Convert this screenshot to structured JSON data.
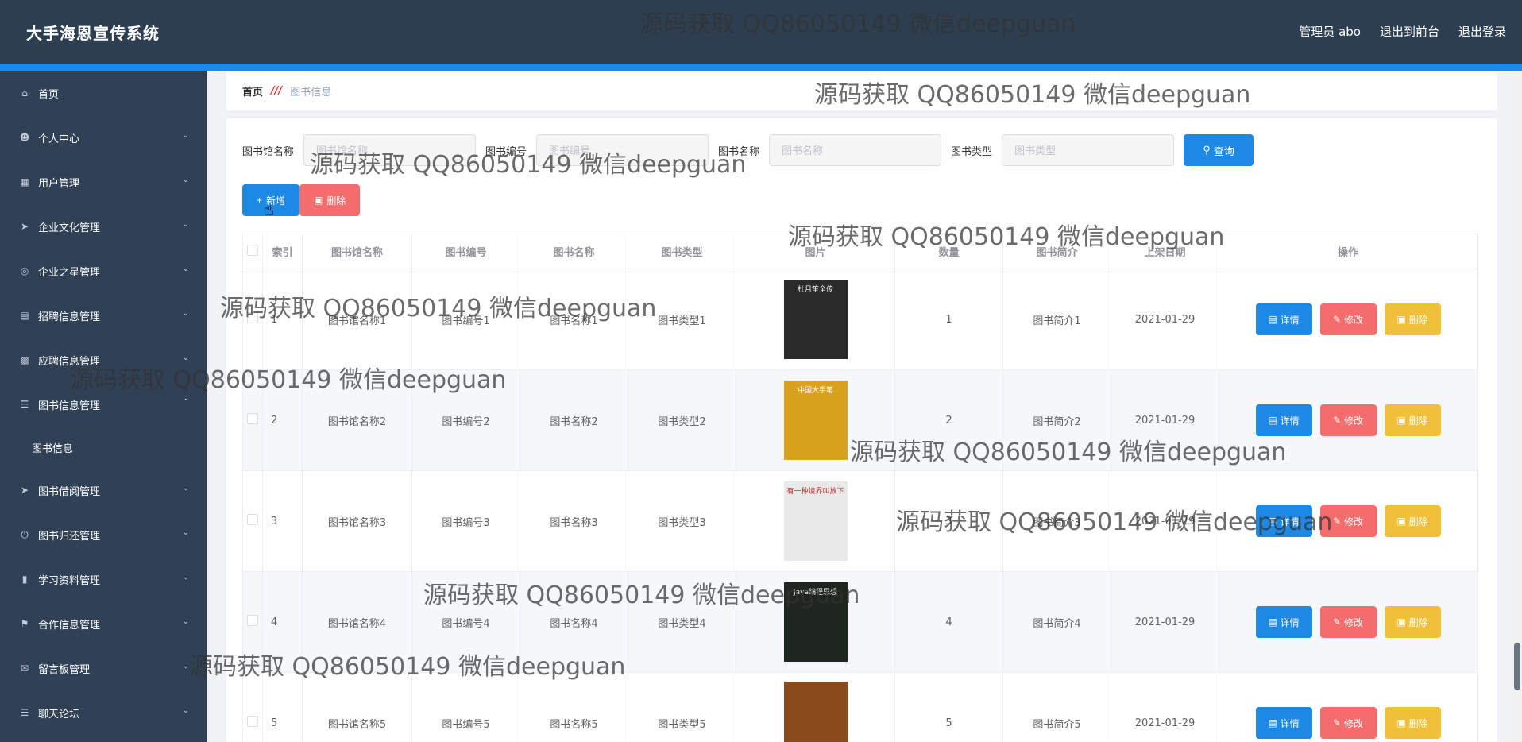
{
  "header": {
    "app_title": "大手海恩宣传系统",
    "admin": "管理员 abo",
    "to_front": "退出到前台",
    "logout": "退出登录"
  },
  "sidebar": {
    "items": [
      {
        "label": "首页",
        "icon": "home-icon",
        "expandable": false
      },
      {
        "label": "个人中心",
        "icon": "user-icon",
        "expandable": true
      },
      {
        "label": "用户管理",
        "icon": "users-icon",
        "expandable": true
      },
      {
        "label": "企业文化管理",
        "icon": "send-icon",
        "expandable": true
      },
      {
        "label": "企业之星管理",
        "icon": "target-icon",
        "expandable": true
      },
      {
        "label": "招聘信息管理",
        "icon": "briefcase-icon",
        "expandable": true
      },
      {
        "label": "应聘信息管理",
        "icon": "ticket-icon",
        "expandable": true
      },
      {
        "label": "图书信息管理",
        "icon": "list-icon",
        "expandable": true,
        "open": true
      },
      {
        "label": "图书信息",
        "icon": "",
        "expandable": false,
        "sub": true
      },
      {
        "label": "图书借阅管理",
        "icon": "send-icon",
        "expandable": true
      },
      {
        "label": "图书归还管理",
        "icon": "power-icon",
        "expandable": true
      },
      {
        "label": "学习资料管理",
        "icon": "bar-chart-icon",
        "expandable": true
      },
      {
        "label": "合作信息管理",
        "icon": "flag-icon",
        "expandable": true
      },
      {
        "label": "留言板管理",
        "icon": "chat-icon",
        "expandable": true
      },
      {
        "label": "聊天论坛",
        "icon": "forum-icon",
        "expandable": true
      }
    ]
  },
  "breadcrumb": {
    "home": "首页",
    "current": "图书信息"
  },
  "search": {
    "fields": [
      {
        "label": "图书馆名称",
        "placeholder": "图书馆名称"
      },
      {
        "label": "图书编号",
        "placeholder": "图书编号"
      },
      {
        "label": "图书名称",
        "placeholder": "图书名称"
      },
      {
        "label": "图书类型",
        "placeholder": "图书类型"
      }
    ],
    "query_label": "查询"
  },
  "actions": {
    "add_label": "新增",
    "delete_label": "删除"
  },
  "table": {
    "headers": [
      "索引",
      "图书馆名称",
      "图书编号",
      "图书名称",
      "图书类型",
      "图片",
      "数量",
      "图书简介",
      "上架日期",
      "操作"
    ],
    "rows": [
      {
        "index": "1",
        "library": "图书馆名称1",
        "code": "图书编号1",
        "name": "图书名称1",
        "type": "图书类型1",
        "qty": "1",
        "intro": "图书简介1",
        "date": "2021-01-29",
        "cover": "#2a2a2a",
        "cover_text": "杜月笙全传"
      },
      {
        "index": "2",
        "library": "图书馆名称2",
        "code": "图书编号2",
        "name": "图书名称2",
        "type": "图书类型2",
        "qty": "2",
        "intro": "图书简介2",
        "date": "2021-01-29",
        "cover": "#d8a21e",
        "cover_text": "中国大手笔"
      },
      {
        "index": "3",
        "library": "图书馆名称3",
        "code": "图书编号3",
        "name": "图书名称3",
        "type": "图书类型3",
        "qty": "3",
        "intro": "图书简介3",
        "date": "2021-01-29",
        "cover": "#e9e9e9",
        "cover_text": "有一种境界叫放下"
      },
      {
        "index": "4",
        "library": "图书馆名称4",
        "code": "图书编号4",
        "name": "图书名称4",
        "type": "图书类型4",
        "qty": "4",
        "intro": "图书简介4",
        "date": "2021-01-29",
        "cover": "#1f2620",
        "cover_text": "Java编程思想"
      },
      {
        "index": "5",
        "library": "图书馆名称5",
        "code": "图书编号5",
        "name": "图书名称5",
        "type": "图书类型5",
        "qty": "5",
        "intro": "图书简介5",
        "date": "2021-01-29",
        "cover": "#8a4a1c",
        "cover_text": ""
      }
    ],
    "op_labels": {
      "detail": "详情",
      "edit": "修改",
      "remove": "删除"
    }
  },
  "watermark": "源码获取 QQ86050149 微信deepguan"
}
